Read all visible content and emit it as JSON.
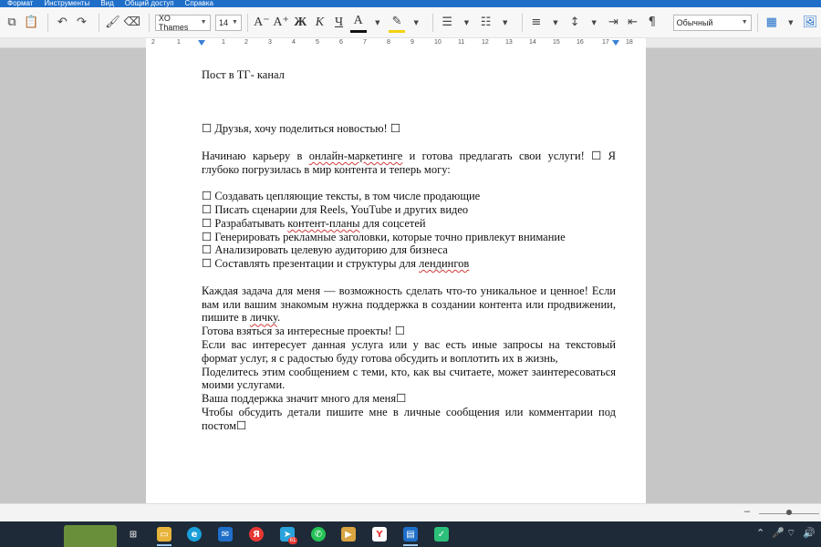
{
  "menu": {
    "items": [
      "Формат",
      "Инструменты",
      "Вид",
      "Общий доступ",
      "Справка"
    ]
  },
  "toolbar": {
    "font_name": "XO Thames",
    "font_size": "14",
    "style_name": "Обычный",
    "bold_label": "Ж",
    "italic_label": "К",
    "underline_label": "Ч",
    "font_color_label": "A",
    "grow_font_label": "A⁺",
    "shrink_font_label": "A⁻"
  },
  "ruler": {
    "labels": [
      "2",
      "1",
      "1",
      "2",
      "3",
      "4",
      "5",
      "6",
      "7",
      "8",
      "9",
      "10",
      "11",
      "12",
      "13",
      "14",
      "15",
      "16",
      "17",
      "18"
    ]
  },
  "document": {
    "title": "Пост в ТГ- канал",
    "intro": "☐ Друзья, хочу поделиться новостью! ☐",
    "para1_a": "Начинаю карьеру в ",
    "para1_link": "онлайн-маркетинге",
    "para1_b": " и готова предлагать свои услуги! ☐ Я глубоко погрузилась в мир контента и теперь могу:",
    "list": [
      {
        "a": "☐ Создавать цепляющие тексты, в том числе продающие",
        "u": "",
        "b": ""
      },
      {
        "a": "☐ Писать сценарии для Reels, YouTube и других видео",
        "u": "",
        "b": ""
      },
      {
        "a": "☐ Разрабатывать ",
        "u": "контент-планы",
        "b": " для соцсетей"
      },
      {
        "a": "☐ Генерировать рекламные заголовки, которые точно привлекут внимание",
        "u": "",
        "b": ""
      },
      {
        "a": "☐ Анализировать целевую аудиторию для бизнеса",
        "u": "",
        "b": ""
      },
      {
        "a": "☐ Составлять презентации и структуры для ",
        "u": "лендингов",
        "b": ""
      }
    ],
    "para2_a": "Каждая задача для меня — возможность сделать что-то уникальное и ценное! Если вам или вашим знакомым нужна поддержка в создании контента или продвижении, пишите в ",
    "para2_link": "личку",
    "para2_b": ".",
    "line_ready": "Готова взяться за интересные проекты! ☐",
    "para3": "Если вас интересует данная услуга или у вас есть иные запросы на текстовый формат услуг, я с радостью буду готова обсудить и воплотить их в жизнь,",
    "para4": "Поделитесь этим сообщением с теми, кто, как вы считаете, может заинтересоваться моими услугами.",
    "line_support": "Ваша поддержка значит много для меня☐",
    "para5": "Чтобы обсудить детали пишите мне в личные сообщения или комментарии под постом☐"
  },
  "statusbar": {
    "zoom_minus": "–"
  },
  "taskbar": {
    "telegram_badge": "61",
    "yandex_letter": "Я"
  },
  "colors": {
    "menubar": "#1f6fc9",
    "taskbar": "#1e2a38",
    "spellcheck": "#d23b3b"
  }
}
